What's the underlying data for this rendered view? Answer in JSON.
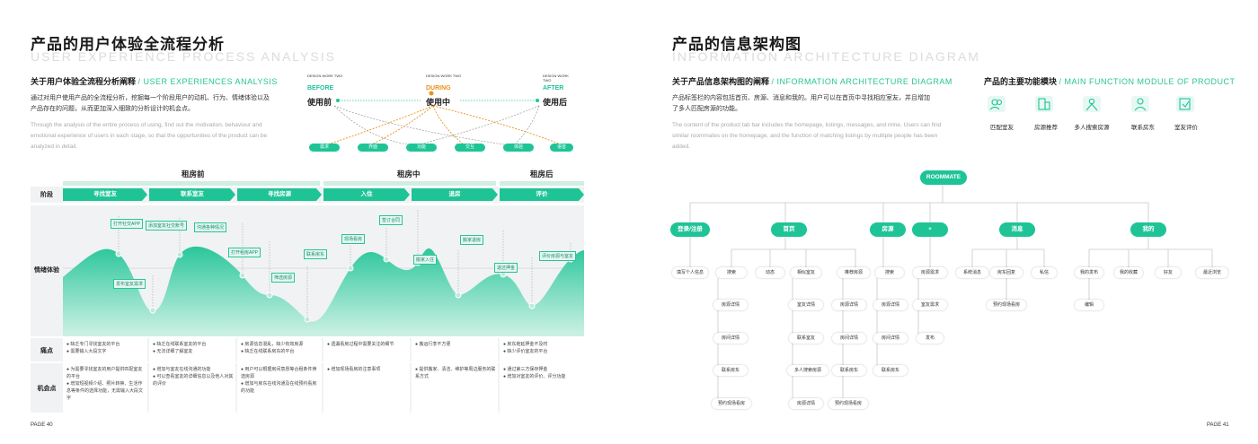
{
  "left": {
    "title": "产品的用户体验全流程分析",
    "title_en": "USER EXPERIENCE PROCESS ANALYSIS",
    "subtitle": "关于用户体验全流程分析阐释",
    "subtitle_en": "/ USER EXPERIENCES ANALYSIS",
    "para_cn": "通过对用户使用产品的全流程分析，挖掘每一个阶段用户的动机、行为、情绪体验以及产品存在的问题，从而更加深入细致的分析设计的机会点。",
    "para_en": "Through the analysis of the entire process of using, find out the motivation, behaviour and emotional experience of users in each stage, so that the opportunities of the product can be analyzed in detail.",
    "page": "PAGE 40",
    "design_small": [
      "DESIGN WORK TWO",
      "DESIGN WORK TWO",
      "DESIGN WORK TWO"
    ],
    "stages_en": [
      "BEFORE",
      "DURING",
      "AFTER"
    ],
    "stages_cn": [
      "使用前",
      "使用中",
      "使用后"
    ],
    "flow_pills": [
      "需求",
      "界面",
      "功能",
      "交互",
      "体验",
      "语音"
    ],
    "phases": [
      "租房前",
      "租房中",
      "租房后"
    ],
    "row_labels": [
      "阶段",
      "情绪体验",
      "痛点",
      "机会点"
    ],
    "steps": [
      "寻找室友",
      "联系室友",
      "寻找房源",
      "入住",
      "退房",
      "评价"
    ],
    "emotion_tags": [
      "打开社交APP",
      "发布室友需求",
      "添加室友社交账号",
      "沟通各种情况",
      "打开租房APP",
      "筛选房源",
      "联系房东",
      "现场看房",
      "签订合同",
      "搬家入住",
      "搬家退房",
      "退还押金",
      "评价房源与室友"
    ],
    "pain_points": [
      [
        "缺乏专门寻找室友的平台",
        "需要输入大段文字"
      ],
      [
        "缺乏在线联系室友的平台",
        "无法详细了解室友"
      ],
      [
        "房源信息混乱，缺少有效房源",
        "缺乏在线联系房东的平台"
      ],
      [
        "遗漏看房过程中需要关注的细节"
      ],
      [
        "搬运行李不方便"
      ],
      [
        "房东拖延押金不及时",
        "缺少评价室友的平台"
      ]
    ],
    "opportunities": [
      [
        "为需要寻找室友的用户提供匹配室友的平台",
        "增加短视频介绍、照片转换、生活作息等条件的选择功能，无需输入大段文字"
      ],
      [
        "增加与室友在线沟通的功能",
        "可以查看室友的详细信息以及他人对其的评价"
      ],
      [
        "用户可以根据房间意愿等合租条件筛选房源",
        "增加与房东在线沟通及在线预约看房的功能"
      ],
      [
        "增加现场看房的注意事项"
      ],
      [
        "提供搬家、清洁、维护等周边服务的联系方式"
      ],
      [
        "通过第三方保存押金",
        "增加对室友的评价、评分功能"
      ]
    ]
  },
  "right": {
    "title": "产品的信息架构图",
    "title_en": "INFORMATION ARCHITECTURE DIAGRAM",
    "subtitle": "关于产品信息架构图的阐释",
    "subtitle_en": "/ INFORMATION ARCHITECTURE DIAGRAM",
    "para_cn": "产品标签栏的内容包括首页、房源、消息和我的。用户可以在首页中寻找相应室友，并且增加了多人匹配房源的功能。",
    "para_en": "The content of the product tab bar includes the homepage, listings, messages, and mine. Users can find similar roommates on the homepage, and the function of matching listings by multiple people has been added.",
    "module_title": "产品的主要功能模块",
    "module_title_en": "/ MAIN FUNCTION MODULE OF PRODUCT",
    "modules": [
      {
        "label": "匹配室友",
        "icon": "people-icon"
      },
      {
        "label": "房源推荐",
        "icon": "building-icon"
      },
      {
        "label": "多人搜索房源",
        "icon": "group-icon"
      },
      {
        "label": "联系房东",
        "icon": "person-icon"
      },
      {
        "label": "室友评价",
        "icon": "review-icon"
      }
    ],
    "root": "ROOMMATE",
    "l1": [
      "登录/注册",
      "首页",
      "房源",
      "+",
      "消息",
      "我的"
    ],
    "login_children": [
      "填写个人信息"
    ],
    "home_children": [
      "搜索",
      "动态",
      "相似室友",
      "推荐房源"
    ],
    "home_search": [
      "房源详情",
      "房间详情",
      "联系房东",
      "预约现场看房"
    ],
    "home_similar": [
      "室友详情",
      "联系室友",
      "多人搜索房源",
      "房源详情"
    ],
    "home_reco": [
      "房源详情",
      "房间详情",
      "联系房东",
      "预约现场看房"
    ],
    "listing_children": [
      "搜索",
      "房源详情",
      "房间详情",
      "联系房东",
      "预约现场看房"
    ],
    "plus_children": [
      "房源需求",
      "室友需求",
      "发布"
    ],
    "msg_children": [
      "系统消息",
      "房东回复",
      "私信"
    ],
    "msg_sub": [
      "预约现场看房"
    ],
    "mine_children": [
      "我的发布",
      "我的收藏",
      "好友",
      "最近浏览"
    ],
    "mine_sub": [
      "编辑"
    ],
    "page": "PAGE 41"
  },
  "colors": {
    "accent": "#1fc496",
    "dark_orange": "#e8911c"
  }
}
